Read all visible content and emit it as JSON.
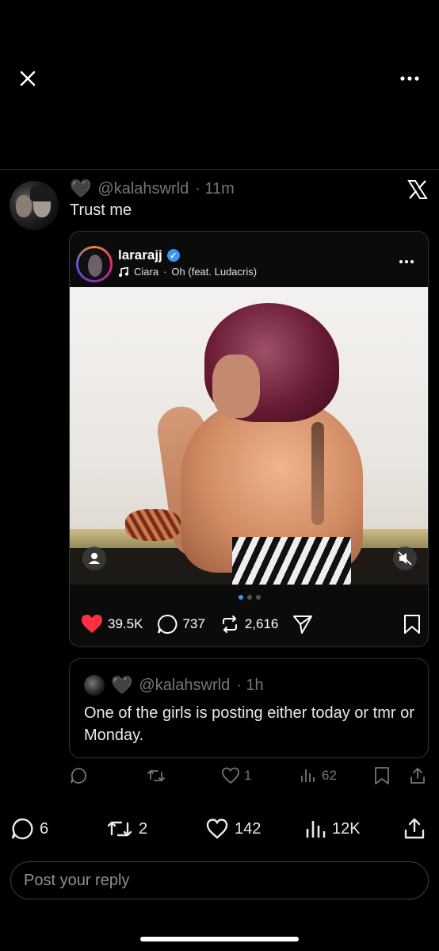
{
  "header": {
    "close_icon": "close-icon",
    "more_icon": "more-icon"
  },
  "tweet": {
    "heart_emoji": "🖤",
    "handle": "@kalahswrld",
    "time": "· 11m",
    "text": "Trust me"
  },
  "embed": {
    "username": "lararajj",
    "verified": "✓",
    "song_artist": "Ciara",
    "song_sep": "·",
    "song_title": "Oh (feat. Ludacris)",
    "likes": "39.5K",
    "comments": "737",
    "reposts": "2,616",
    "carousel_pages": 3,
    "carousel_active": 1
  },
  "quote": {
    "heart_emoji": "🖤",
    "handle": "@kalahswrld",
    "time": "· 1h",
    "text": "One of the girls is posting either today or tmr or Monday."
  },
  "inner_actions": {
    "likes": "1",
    "views": "62"
  },
  "main_actions": {
    "replies": "6",
    "reposts": "2",
    "likes": "142",
    "views": "12K"
  },
  "reply": {
    "placeholder": "Post your reply"
  },
  "colors": {
    "background": "#000000",
    "muted": "#71767b",
    "text": "#e7e9ea",
    "like_red": "#ff3040",
    "verified_blue": "#3897f0"
  }
}
